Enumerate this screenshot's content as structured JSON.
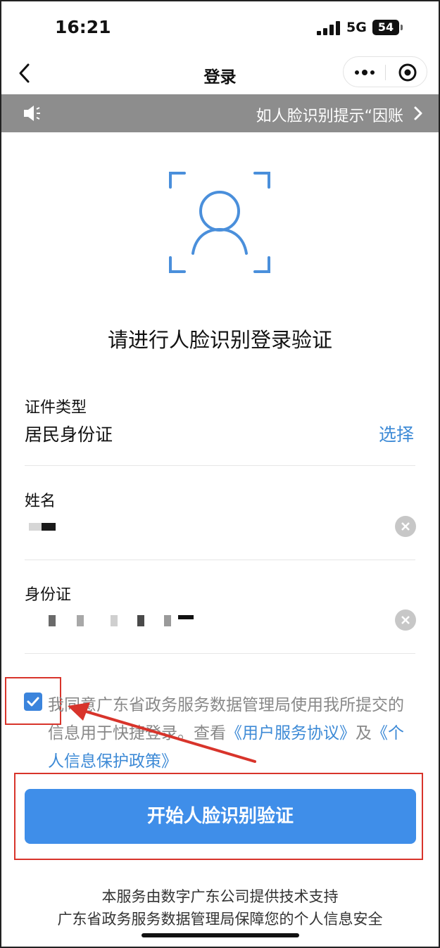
{
  "status_bar": {
    "time": "16:21",
    "network": "5G",
    "battery": "54"
  },
  "nav": {
    "title": "登录",
    "back_icon": "chevron-left-icon",
    "more_icon": "more-dots-icon",
    "close_icon": "target-close-icon"
  },
  "notice": {
    "text": "如人脸识别提示“因账",
    "icon": "speaker-icon"
  },
  "face_icon": "face-scan-icon",
  "headline": "请进行人脸识别登录验证",
  "form": {
    "id_type_label": "证件类型",
    "id_type_value": "居民身份证",
    "select_label": "选择",
    "name_label": "姓名",
    "id_number_label": "身份证"
  },
  "agreement": {
    "checked": true,
    "text": "我同意广东省政务服务数据管理局使用我所提交的信息用于快捷登录。查看",
    "user_agreement": "《用户服务协议》",
    "connector": "及",
    "privacy_policy": "《个人信息保护政策》"
  },
  "primary_button": "开始人脸识别验证",
  "footer": {
    "line1": "本服务由数字广东公司提供技术支持",
    "line2": "广东省政务服务数据管理局保障您的个人信息安全"
  },
  "colors": {
    "accent": "#3f8ee9",
    "link": "#3d8ad6",
    "annotation": "#d8342b",
    "notice_bg": "#8d8d8d"
  }
}
